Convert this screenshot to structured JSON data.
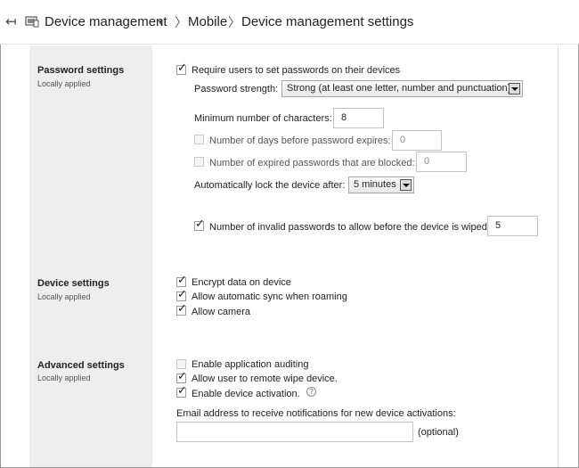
{
  "header": {
    "back_icon": "back-arrow-icon",
    "section_icon": "device-management-icon",
    "breadcrumb": [
      "Device management",
      "Mobile",
      "Device management settings"
    ],
    "separator": "〉"
  },
  "sections": {
    "password": {
      "title": "Password settings",
      "subtitle": "Locally applied",
      "require_label": "Require users to set passwords on their devices",
      "require_checked": true,
      "strength_label": "Password strength:",
      "strength_value": "Strong (at least one letter, number and punctuation)",
      "min_chars_label": "Minimum number of characters:",
      "min_chars_value": "8",
      "expire_label": "Number of days before password expires:",
      "expire_value": "0",
      "expire_checked": false,
      "blocked_label": "Number of expired passwords that are blocked:",
      "blocked_value": "0",
      "blocked_checked": false,
      "autolock_label": "Automatically lock the device after:",
      "autolock_value": "5 minutes",
      "wipe_label": "Number of invalid passwords to allow before the device is wiped:",
      "wipe_value": "5",
      "wipe_checked": true
    },
    "device": {
      "title": "Device settings",
      "subtitle": "Locally applied",
      "items": [
        {
          "label": "Encrypt data on device",
          "checked": true
        },
        {
          "label": "Allow automatic sync when roaming",
          "checked": true
        },
        {
          "label": "Allow camera",
          "checked": true
        }
      ]
    },
    "advanced": {
      "title": "Advanced settings",
      "subtitle": "Locally applied",
      "items": [
        {
          "label": "Enable application auditing",
          "checked": false
        },
        {
          "label": "Allow user to remote wipe device.",
          "checked": true
        },
        {
          "label": "Enable device activation.",
          "checked": true
        }
      ],
      "help_icon": "help-icon",
      "help_glyph": "?",
      "email_label": "Email address to receive notifications for new device activations:",
      "email_value": "",
      "optional_label": "(optional)"
    }
  }
}
